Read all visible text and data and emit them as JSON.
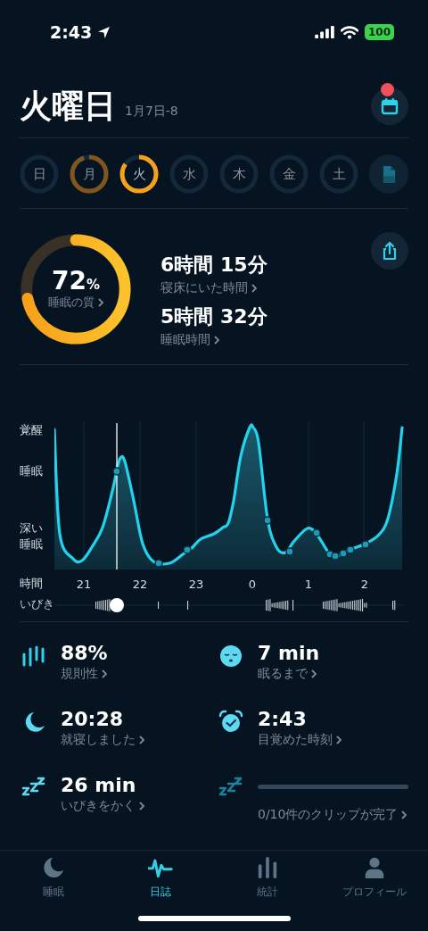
{
  "status_bar": {
    "time": "2:43",
    "battery": "100"
  },
  "header": {
    "title": "火曜日",
    "date": "1月7日-8",
    "has_notification": true
  },
  "days": [
    {
      "label": "日",
      "level": 0,
      "selected": false
    },
    {
      "label": "月",
      "level": 0.95,
      "selected": false
    },
    {
      "label": "火",
      "level": 0.85,
      "selected": true
    },
    {
      "label": "水",
      "level": 0,
      "selected": false
    },
    {
      "label": "木",
      "level": 0,
      "selected": false
    },
    {
      "label": "金",
      "level": 0,
      "selected": false
    },
    {
      "label": "土",
      "level": 0,
      "selected": false
    }
  ],
  "summary": {
    "quality": {
      "value": "72",
      "unit": "%",
      "label": "睡眠の質",
      "level": 0.72
    },
    "items": [
      {
        "value": "6時間 15分",
        "label": "寝床にいた時間"
      },
      {
        "value": "5時間 32分",
        "label": "睡眠時間"
      }
    ]
  },
  "chart": {
    "y_labels": [
      "覚醒",
      "睡眠",
      "深い睡眠"
    ],
    "x_title": "時間",
    "x_labels": [
      "21",
      "22",
      "23",
      "0",
      "1",
      "2"
    ],
    "snore_label": "いびき"
  },
  "stats": [
    {
      "kind": "metric",
      "value": "88%",
      "label": "規則性"
    },
    {
      "kind": "metric",
      "value": "7 min",
      "label": "眠るまで"
    },
    {
      "kind": "metric",
      "value": "20:28",
      "label": "就寝しました"
    },
    {
      "kind": "metric",
      "value": "2:43",
      "label": "目覚めた時刻"
    },
    {
      "kind": "metric",
      "value": "26 min",
      "label": "いびきをかく"
    },
    {
      "kind": "progress",
      "level": 0,
      "label": "0/10件のクリップが完了"
    }
  ],
  "tabs": [
    {
      "label": "睡眠",
      "selected": false
    },
    {
      "label": "日誌",
      "selected": true
    },
    {
      "label": "統計",
      "selected": false
    },
    {
      "label": "プロフィール",
      "selected": false
    }
  ]
}
